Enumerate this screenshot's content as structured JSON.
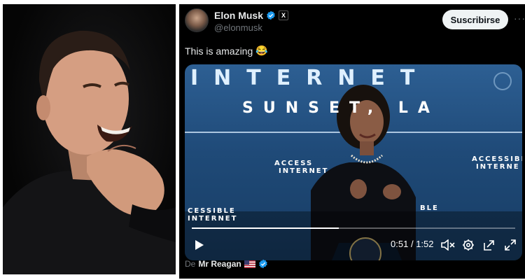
{
  "tweet": {
    "author_name": "Elon Musk",
    "handle": "@elonmusk",
    "x_badge": "X",
    "subscribe_label": "Suscribirse",
    "more_label": "···",
    "text": "This is amazing",
    "emoji": "😂"
  },
  "video": {
    "banner_word": "INTERNET",
    "banner_city": "SUNSET, LA",
    "access_left_1": "ACCESS",
    "access_left_2": "INTERNET",
    "access_right_1": "ACCESSIBLE",
    "access_right_2": "INTERNE",
    "access_bottom_1": "CESSIBLE",
    "access_bottom_2": "INTERNET",
    "access_mid": "BLE",
    "current_time": "0:51",
    "separator": "/",
    "duration": "1:52",
    "progress": 0.455
  },
  "credit": {
    "prefix": "De",
    "source_name": "Mr Reagan"
  },
  "colors": {
    "verified": "#1d9bf0",
    "video_bg": "#2d5f93"
  },
  "icons": [
    "verified-badge-icon",
    "x-logo-icon",
    "play-icon",
    "mute-icon",
    "settings-icon",
    "picture-in-picture-icon",
    "fullscreen-icon",
    "us-flag-icon"
  ]
}
